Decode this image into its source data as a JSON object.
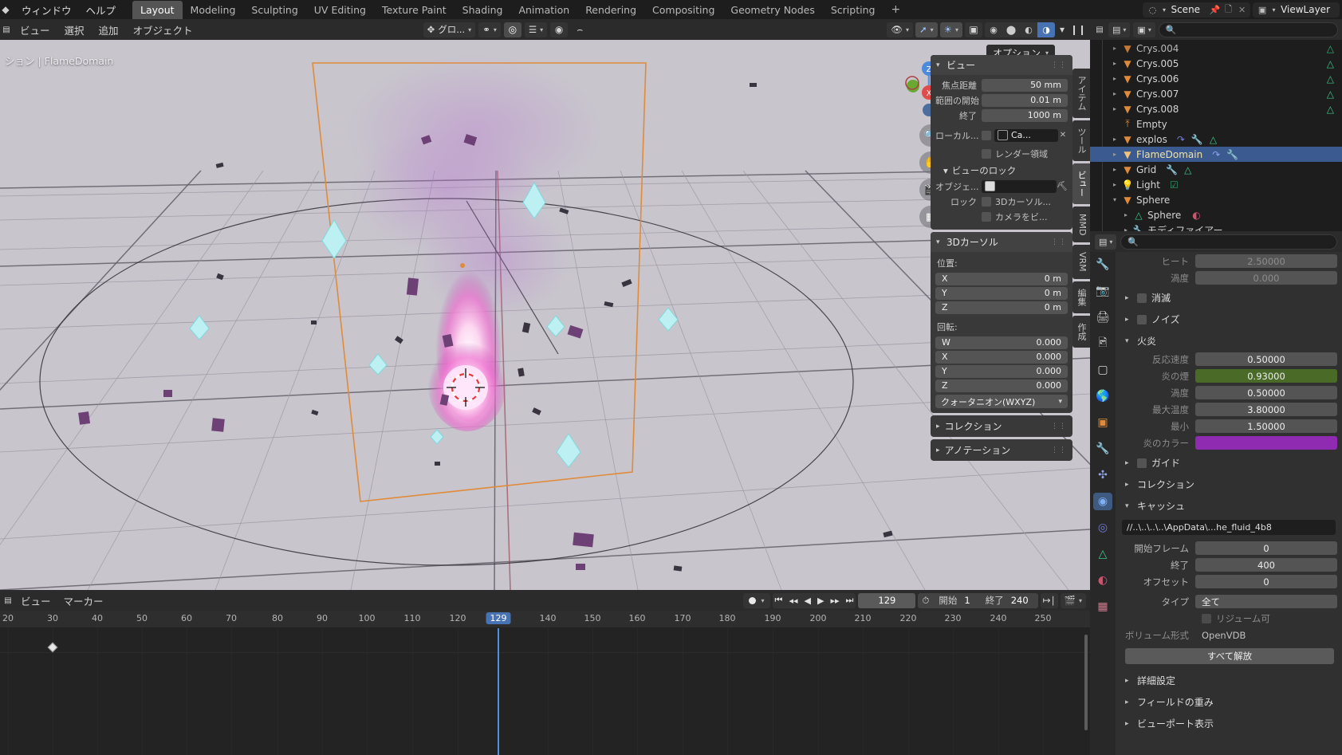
{
  "topbar": {
    "menus": [
      "ウィンドウ",
      "ヘルプ"
    ],
    "workspace_tabs": [
      {
        "label": "Layout",
        "active": true
      },
      {
        "label": "Modeling",
        "active": false
      },
      {
        "label": "Sculpting",
        "active": false
      },
      {
        "label": "UV Editing",
        "active": false
      },
      {
        "label": "Texture Paint",
        "active": false
      },
      {
        "label": "Shading",
        "active": false
      },
      {
        "label": "Animation",
        "active": false
      },
      {
        "label": "Rendering",
        "active": false
      },
      {
        "label": "Compositing",
        "active": false
      },
      {
        "label": "Geometry Nodes",
        "active": false
      },
      {
        "label": "Scripting",
        "active": false
      }
    ],
    "add_tab": "+",
    "scene_name": "Scene",
    "viewlayer_name": "ViewLayer",
    "scene_icon": "scene-icon",
    "pin_icon": "pin-icon",
    "copy_icon": "new-scene-icon",
    "close_icon": "delete-scene-icon",
    "viewlayer_icon": "viewlayer-icon"
  },
  "viewport": {
    "menus": [
      "ビュー",
      "選択",
      "追加",
      "オブジェクト"
    ],
    "transform_orientation": "グロ...",
    "options_label": "オプション",
    "status_text": "ション | FlameDomain",
    "gizmo_axes": [
      "X",
      "Y",
      "Z"
    ],
    "nav_icons": [
      "zoom-icon",
      "hand-icon",
      "camera-icon",
      "grid-icon"
    ],
    "shading_modes": [
      "wireframe-icon",
      "solid-icon",
      "material-icon",
      "rendered-icon"
    ],
    "active_shading": "rendered-icon"
  },
  "npanel": {
    "tabs": [
      {
        "label": "アイテム",
        "active": false
      },
      {
        "label": "ツール",
        "active": false
      },
      {
        "label": "ビュー",
        "active": true
      },
      {
        "label": "MMD",
        "active": false
      },
      {
        "label": "VRM",
        "active": false
      },
      {
        "label": "編集",
        "active": false
      },
      {
        "label": "作成",
        "active": false
      }
    ],
    "view_section": {
      "title": "ビュー",
      "rows": [
        {
          "label": "焦点距離",
          "value": "50 mm"
        },
        {
          "label": "範囲の開始",
          "value": "0.01 m"
        },
        {
          "label": "終了",
          "value": "1000 m"
        }
      ],
      "local_camera_label": "ローカル...",
      "local_camera_value": "Ca...",
      "render_region_label": "レンダー領域"
    },
    "view_lock_section": {
      "title": "ビューのロック",
      "object_label": "オブジェ...",
      "object_value": "",
      "lock_label": "ロック",
      "lock_opt1": "3Dカーソル...",
      "lock_opt2": "カメラをビ..."
    },
    "cursor_section": {
      "title": "3Dカーソル",
      "position_label": "位置:",
      "position": [
        {
          "axis": "X",
          "value": "0 m"
        },
        {
          "axis": "Y",
          "value": "0 m"
        },
        {
          "axis": "Z",
          "value": "0 m"
        }
      ],
      "rotation_label": "回転:",
      "rotation": [
        {
          "axis": "W",
          "value": "0.000"
        },
        {
          "axis": "X",
          "value": "0.000"
        },
        {
          "axis": "Y",
          "value": "0.000"
        },
        {
          "axis": "Z",
          "value": "0.000"
        }
      ],
      "rotation_mode": "クォータニオン(WXYZ)"
    },
    "collection_section": "コレクション",
    "annotation_section": "アノテーション"
  },
  "outliner": {
    "display_mode_icon": "outliner-filter-icon",
    "filter_icon": "filter-icon",
    "search_placeholder": "",
    "rows": [
      {
        "name": "Crys.004",
        "indent": 1,
        "icon": "mesh-object-icon",
        "expandable": true,
        "selected": false,
        "badges": [
          "mesh-data-icon"
        ]
      },
      {
        "name": "Crys.005",
        "indent": 1,
        "icon": "mesh-object-icon",
        "expandable": true,
        "selected": false,
        "badges": [
          "mesh-data-icon"
        ]
      },
      {
        "name": "Crys.006",
        "indent": 1,
        "icon": "mesh-object-icon",
        "expandable": true,
        "selected": false,
        "badges": [
          "mesh-data-icon"
        ]
      },
      {
        "name": "Crys.007",
        "indent": 1,
        "icon": "mesh-object-icon",
        "expandable": true,
        "selected": false,
        "badges": [
          "mesh-data-icon"
        ]
      },
      {
        "name": "Crys.008",
        "indent": 1,
        "icon": "mesh-object-icon",
        "expandable": true,
        "selected": false,
        "badges": [
          "mesh-data-icon"
        ]
      },
      {
        "name": "Empty",
        "indent": 1,
        "icon": "empty-object-icon",
        "expandable": false,
        "selected": false,
        "badges": []
      },
      {
        "name": "explos",
        "indent": 1,
        "icon": "mesh-object-icon",
        "expandable": true,
        "selected": false,
        "badges": [
          "animation-icon",
          "modifier-icon",
          "mesh-data-icon"
        ]
      },
      {
        "name": "FlameDomain",
        "indent": 1,
        "icon": "mesh-object-icon",
        "expandable": true,
        "selected": true,
        "badges": [
          "animation-icon",
          "modifier-icon"
        ]
      },
      {
        "name": "Grid",
        "indent": 1,
        "icon": "mesh-object-icon",
        "expandable": true,
        "selected": false,
        "badges": [
          "modifier-icon",
          "mesh-data-icon"
        ]
      },
      {
        "name": "Light",
        "indent": 1,
        "icon": "light-object-icon",
        "expandable": true,
        "selected": false,
        "badges": [
          "light-data-icon"
        ]
      },
      {
        "name": "Sphere",
        "indent": 1,
        "icon": "mesh-object-icon",
        "expandable": true,
        "expanded": true,
        "selected": false,
        "badges": []
      },
      {
        "name": "Sphere",
        "indent": 2,
        "icon": "mesh-data-icon",
        "expandable": true,
        "selected": false,
        "badges": [
          "material-icon"
        ]
      },
      {
        "name": "モディファイアー",
        "indent": 2,
        "icon": "modifier-icon",
        "expandable": true,
        "selected": false,
        "badges": []
      }
    ]
  },
  "properties": {
    "editor_icon": "properties-editor-icon",
    "search_placeholder": "",
    "tab_icons": [
      {
        "name": "tool-icon",
        "active": false
      },
      {
        "name": "render-icon",
        "active": false
      },
      {
        "name": "output-icon",
        "active": false
      },
      {
        "name": "viewlayer-icon",
        "active": false
      },
      {
        "name": "scene-icon",
        "active": false
      },
      {
        "name": "world-icon",
        "active": false
      },
      {
        "name": "object-icon",
        "active": false
      },
      {
        "name": "modifier-icon",
        "active": false
      },
      {
        "name": "particles-icon",
        "active": false
      },
      {
        "name": "physics-icon",
        "active": true
      },
      {
        "name": "constraints-icon",
        "active": false
      },
      {
        "name": "data-icon",
        "active": false
      },
      {
        "name": "material-icon",
        "active": false
      },
      {
        "name": "texture-icon",
        "active": false
      }
    ],
    "rows_top": [
      {
        "label": "ヒート",
        "value": "2.50000",
        "dim": true
      },
      {
        "label": "渦度",
        "value": "0.000",
        "dim": true
      }
    ],
    "sections": [
      {
        "label": "消滅",
        "type": "collapsed-check"
      },
      {
        "label": "ノイズ",
        "type": "collapsed-check"
      }
    ],
    "fire_section": {
      "title": "火炎",
      "rows": [
        {
          "label": "反応速度",
          "value": "0.50000",
          "style": "normal"
        },
        {
          "label": "炎の煙",
          "value": "0.93000",
          "style": "green"
        },
        {
          "label": "渦度",
          "value": "0.50000",
          "style": "normal"
        },
        {
          "label": "最大温度",
          "value": "3.80000",
          "style": "normal"
        },
        {
          "label": "最小",
          "value": "1.50000",
          "style": "normal"
        },
        {
          "label": "炎のカラー",
          "value": "",
          "style": "purple"
        }
      ]
    },
    "guide_section": "ガイド",
    "collection_section": "コレクション",
    "cache_section": {
      "title": "キャッシュ",
      "path": "//..\\..\\..\\..\\AppData\\...he_fluid_4b8",
      "rows": [
        {
          "label": "開始フレーム",
          "value": "0"
        },
        {
          "label": "終了",
          "value": "400"
        },
        {
          "label": "オフセット",
          "value": "0"
        },
        {
          "label": "タイプ",
          "value": "全て",
          "align": "left"
        }
      ],
      "resumable_label": "リジューム可",
      "volume_format_label": "ボリューム形式",
      "volume_format_value": "OpenVDB",
      "free_all_button": "すべて解放"
    },
    "bottom_sections": [
      "詳細設定",
      "フィールドの重み",
      "ビューポート表示"
    ]
  },
  "timeline": {
    "menus": [
      "ビュー",
      "マーカー"
    ],
    "auto_key_icon": "record-icon",
    "playback_icons": [
      "jump-start-icon",
      "prev-keyframe-icon",
      "play-reverse-icon",
      "play-icon",
      "next-keyframe-icon",
      "jump-end-icon"
    ],
    "current_frame": "129",
    "start_label": "開始",
    "start_value": "1",
    "end_label": "終了",
    "end_value": "240",
    "sync_icon": "sync-range-icon",
    "editor_icon": "timeline-editor-icon",
    "ruler_ticks": [
      "20",
      "30",
      "40",
      "50",
      "60",
      "70",
      "80",
      "90",
      "100",
      "110",
      "120",
      "129",
      "140",
      "150",
      "160",
      "170",
      "180",
      "190",
      "200",
      "210",
      "220",
      "230",
      "240",
      "250"
    ],
    "playhead_frame": "129",
    "keyframes": [
      "30"
    ]
  },
  "colors": {
    "accent_blue": "#4772b3",
    "selection": "#3b5a8f",
    "green_field": "#4a6b28",
    "purple_field": "#8e2bb0",
    "orange_outline": "#e08b3a"
  }
}
